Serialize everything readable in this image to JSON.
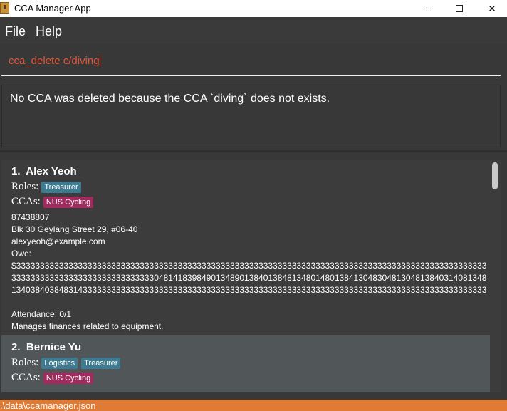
{
  "window": {
    "title": "CCA Manager App"
  },
  "menu": {
    "file": "File",
    "help": "Help"
  },
  "command": {
    "value": "cca_delete c/diving"
  },
  "result": {
    "message": "No CCA was deleted because the CCA `diving` does not exists."
  },
  "persons": [
    {
      "index": "1.",
      "name": "Alex Yeoh",
      "roles_label": "Roles:",
      "roles": [
        "Treasurer"
      ],
      "ccas_label": "CCAs:",
      "ccas": [
        "NUS Cycling"
      ],
      "phone": "87438807",
      "address": "Blk 30 Geylang Street 29, #06-40",
      "email": "alexyeoh@example.com",
      "owe_label": "Owe:",
      "owe_value": "$33333333333333333333333333333333333333333333333333333333333333333333333333333333333333333333333333333333333333333333333333333333304814183984901348901384013848134801480138413048304813048138403140813481340384038483143333333333333333333333333333333333333333333333333333333333333333333333333333333333333",
      "attendance": "Attendance: 0/1",
      "remark": "Manages finances related to equipment."
    },
    {
      "index": "2.",
      "name": "Bernice Yu",
      "roles_label": "Roles:",
      "roles": [
        "Logistics",
        "Treasurer"
      ],
      "ccas_label": "CCAs:",
      "ccas": [
        "NUS Cycling"
      ]
    }
  ],
  "status": {
    "path": ".\\data\\ccamanager.json"
  },
  "colors": {
    "accent": "#e07b36",
    "role_tag": "#3e7b91",
    "cca_tag": "#a12a5e",
    "command_text": "#e0563b"
  },
  "icons": {
    "app": "app-icon",
    "minimize": "minimize-icon",
    "maximize": "maximize-icon",
    "close": "close-icon"
  }
}
